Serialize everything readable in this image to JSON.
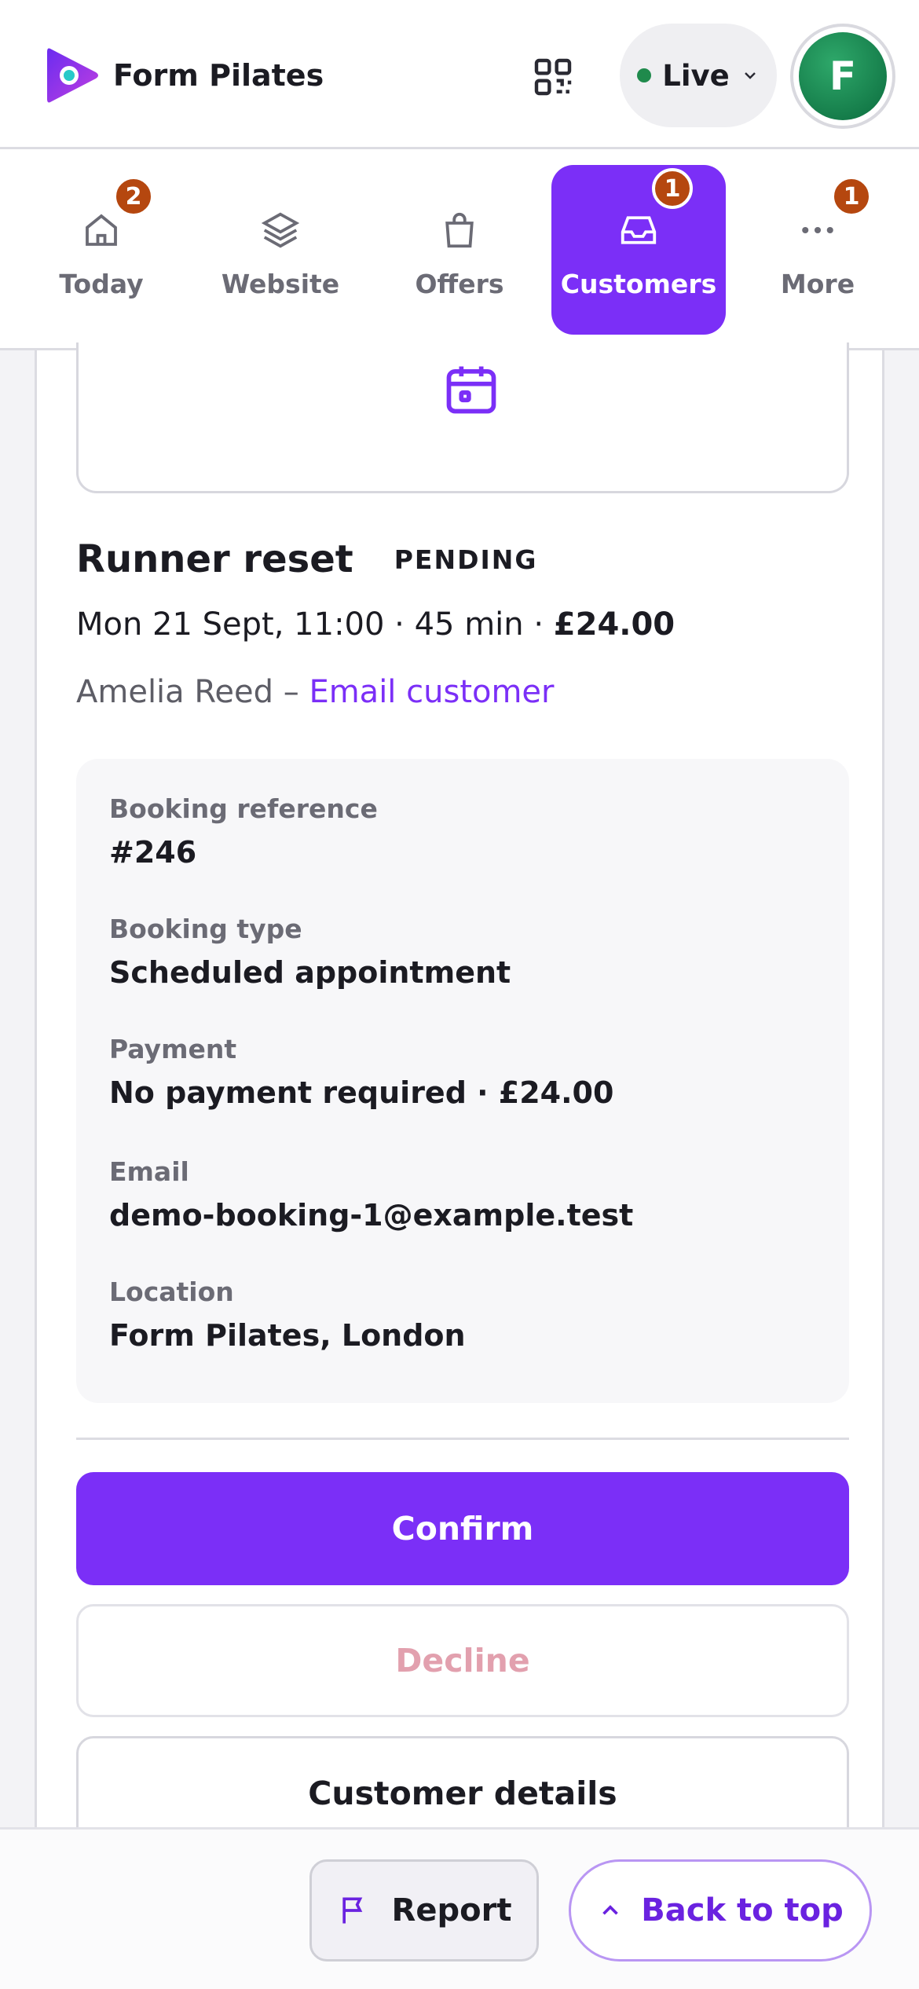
{
  "header": {
    "brand_name": "Form Pilates",
    "status_label": "Live",
    "avatar_initial": "F"
  },
  "tabs": [
    {
      "label": "Today",
      "badge": "2",
      "icon": "home-icon"
    },
    {
      "label": "Website",
      "icon": "layers-icon"
    },
    {
      "label": "Offers",
      "icon": "shopping-bag-icon"
    },
    {
      "label": "Customers",
      "badge": "1",
      "icon": "inbox-icon",
      "active": true
    },
    {
      "label": "More",
      "badge": "1",
      "icon": "more-dots-icon"
    }
  ],
  "booking": {
    "title": "Runner reset",
    "status": "PENDING",
    "date_time": "Mon 21 Sept, 11:00 · 45 min · ",
    "price": "£24.00",
    "customer_name": "Amelia Reed",
    "separator": " – ",
    "email_link": "Email customer",
    "details": [
      {
        "label": "Booking reference",
        "value": "#246"
      },
      {
        "label": "Booking type",
        "value": "Scheduled appointment"
      },
      {
        "label": "Payment",
        "value": "No payment required · £24.00"
      },
      {
        "label": "Email",
        "value": "demo-booking-1@example.test"
      },
      {
        "label": "Location",
        "value": "Form Pilates, London"
      }
    ],
    "actions": {
      "confirm": "Confirm",
      "decline": "Decline",
      "customer_details": "Customer details"
    }
  },
  "footer": {
    "report_label": "Report",
    "back_to_top_label": "Back to top"
  },
  "colors": {
    "accent": "#7b2ff7",
    "badge": "#b5470f",
    "live": "#1f8a4c",
    "decline_text": "#e2a0ae"
  }
}
